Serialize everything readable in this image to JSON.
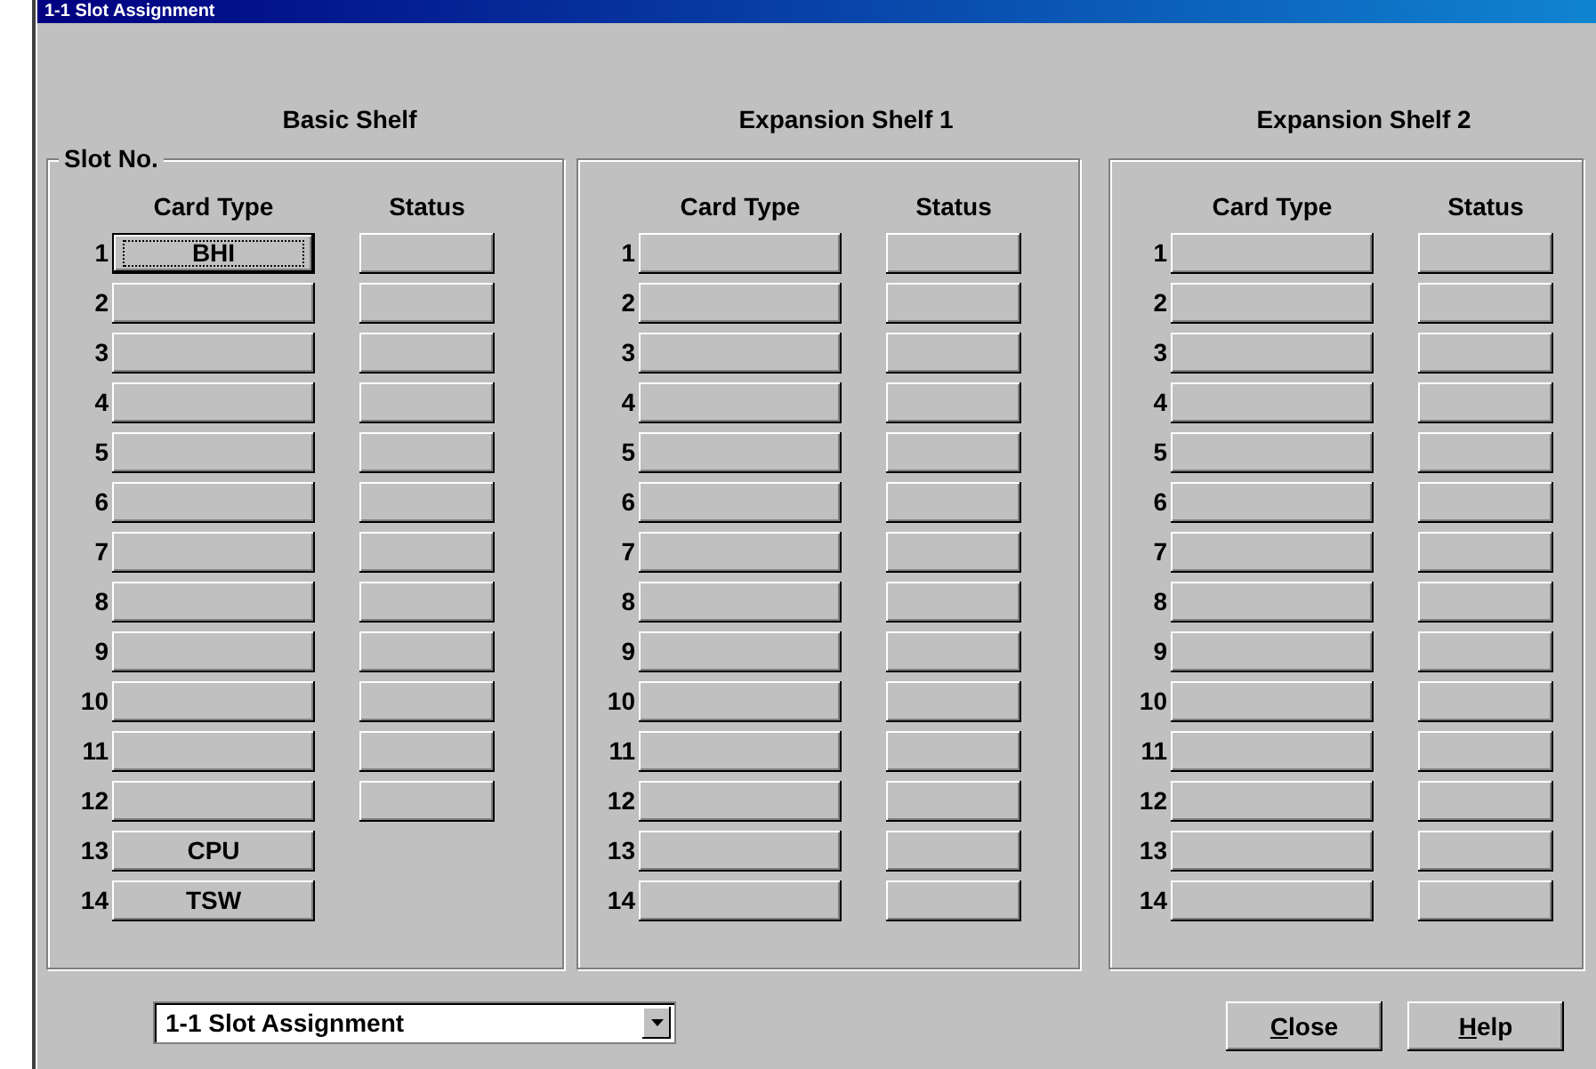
{
  "window": {
    "title": "1-1 Slot Assignment"
  },
  "shelves": [
    {
      "heading": "Basic Shelf",
      "legend": "Slot No.",
      "card_type_header": "Card Type",
      "status_header": "Status",
      "slots": [
        {
          "number": "1",
          "card": "BHI",
          "selected": true,
          "status_button": true
        },
        {
          "number": "2",
          "selected": false,
          "status_button": true
        },
        {
          "number": "3",
          "selected": false,
          "status_button": true
        },
        {
          "number": "4",
          "selected": false,
          "status_button": true
        },
        {
          "number": "5",
          "selected": false,
          "status_button": true
        },
        {
          "number": "6",
          "selected": false,
          "status_button": true
        },
        {
          "number": "7",
          "selected": false,
          "status_button": true
        },
        {
          "number": "8",
          "selected": false,
          "status_button": true
        },
        {
          "number": "9",
          "selected": false,
          "status_button": true
        },
        {
          "number": "10",
          "selected": false,
          "status_button": true
        },
        {
          "number": "11",
          "selected": false,
          "status_button": true
        },
        {
          "number": "12",
          "selected": false,
          "status_button": true
        },
        {
          "number": "13",
          "card": "CPU",
          "selected": false,
          "status_button": false
        },
        {
          "number": "14",
          "card": "TSW",
          "selected": false,
          "status_button": false
        }
      ]
    },
    {
      "heading": "Expansion Shelf 1",
      "card_type_header": "Card Type",
      "status_header": "Status",
      "slots": [
        {
          "number": "1",
          "selected": false,
          "status_button": true
        },
        {
          "number": "2",
          "selected": false,
          "status_button": true
        },
        {
          "number": "3",
          "selected": false,
          "status_button": true
        },
        {
          "number": "4",
          "selected": false,
          "status_button": true
        },
        {
          "number": "5",
          "selected": false,
          "status_button": true
        },
        {
          "number": "6",
          "selected": false,
          "status_button": true
        },
        {
          "number": "7",
          "selected": false,
          "status_button": true
        },
        {
          "number": "8",
          "selected": false,
          "status_button": true
        },
        {
          "number": "9",
          "selected": false,
          "status_button": true
        },
        {
          "number": "10",
          "selected": false,
          "status_button": true
        },
        {
          "number": "11",
          "selected": false,
          "status_button": true
        },
        {
          "number": "12",
          "selected": false,
          "status_button": true
        },
        {
          "number": "13",
          "selected": false,
          "status_button": true
        },
        {
          "number": "14",
          "selected": false,
          "status_button": true
        }
      ]
    },
    {
      "heading": "Expansion Shelf 2",
      "card_type_header": "Card Type",
      "status_header": "Status",
      "slots": [
        {
          "number": "1",
          "selected": false,
          "status_button": true
        },
        {
          "number": "2",
          "selected": false,
          "status_button": true
        },
        {
          "number": "3",
          "selected": false,
          "status_button": true
        },
        {
          "number": "4",
          "selected": false,
          "status_button": true
        },
        {
          "number": "5",
          "selected": false,
          "status_button": true
        },
        {
          "number": "6",
          "selected": false,
          "status_button": true
        },
        {
          "number": "7",
          "selected": false,
          "status_button": true
        },
        {
          "number": "8",
          "selected": false,
          "status_button": true
        },
        {
          "number": "9",
          "selected": false,
          "status_button": true
        },
        {
          "number": "10",
          "selected": false,
          "status_button": true
        },
        {
          "number": "11",
          "selected": false,
          "status_button": true
        },
        {
          "number": "12",
          "selected": false,
          "status_button": true
        },
        {
          "number": "13",
          "selected": false,
          "status_button": true
        },
        {
          "number": "14",
          "selected": false,
          "status_button": true
        }
      ]
    }
  ],
  "view_select": {
    "value": "1-1 Slot Assignment"
  },
  "buttons": [
    {
      "label": "Close"
    },
    {
      "label": "Help"
    }
  ]
}
